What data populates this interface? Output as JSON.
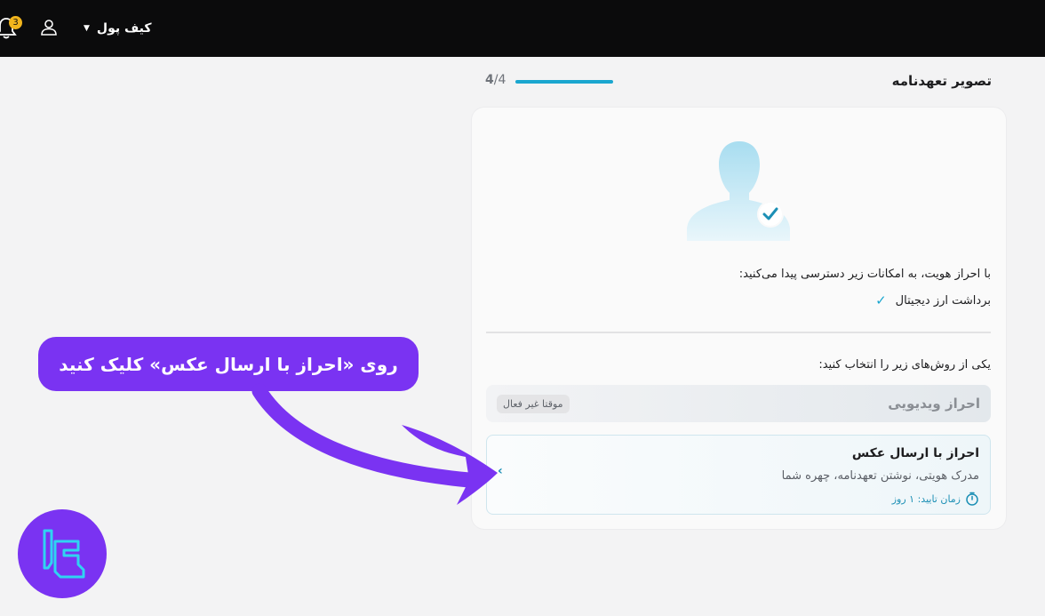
{
  "topbar": {
    "notification_count": "3",
    "wallet_label": "کیف پول",
    "icons": [
      "bell-icon",
      "user-icon",
      "caret-down-icon"
    ]
  },
  "page": {
    "title": "تصویر تعهدنامه",
    "step_current": "4",
    "step_total": "/4",
    "progress": 1.0
  },
  "card": {
    "access_title": "با احراز هویت، به امکانات زیر دسترسی پیدا می‌کنید:",
    "access_items": [
      {
        "label": "برداشت ارز دیجیتال",
        "icon": "check-icon"
      }
    ],
    "choose_label": "یکی از روش‌های زیر را انتخاب کنید:",
    "options": {
      "video": {
        "title": "احراز ویدیویی",
        "badge": "موقتا غیر فعال"
      },
      "photo": {
        "title": "احراز با ارسال عکس",
        "description": "مدرک هویتی، نوشتن تعهدنامه، چهره شما",
        "time": "زمان تایید: ۱ روز",
        "icon": "stopwatch-icon"
      }
    }
  },
  "annotation": {
    "callout_text": "روی «احراز با ارسال عکس» کلیک کنید"
  },
  "colors": {
    "accent": "#1aa6cf",
    "callout": "#7a33f2",
    "topbar": "#0b0b0c",
    "badge": "#f2b51d"
  }
}
